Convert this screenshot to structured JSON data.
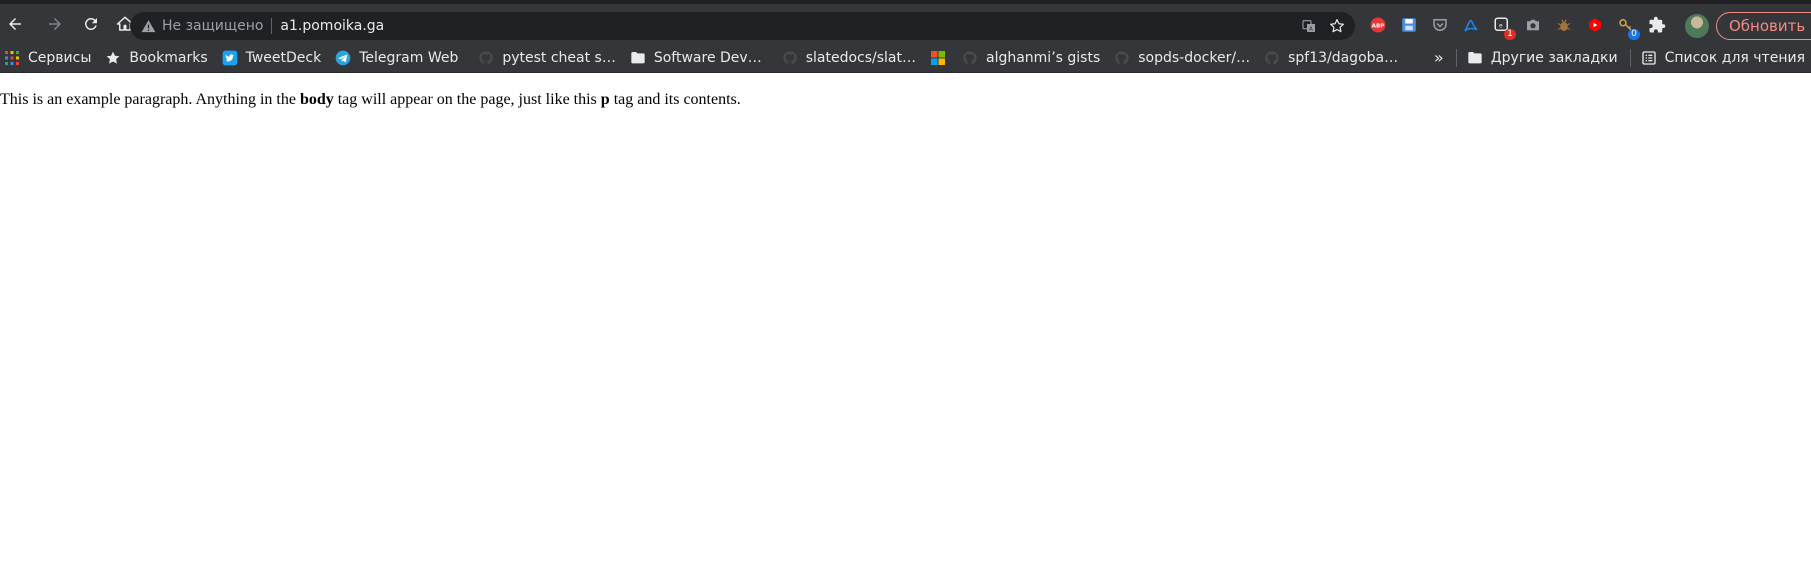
{
  "toolbar": {
    "security_label": "Не защищено",
    "url": "a1.pomoika.ga",
    "update_label": "Обновить",
    "extensions": [
      {
        "name": "adblock-plus-icon",
        "label": "ABP",
        "color": "#e53935"
      },
      {
        "name": "save-icon",
        "color": "#4a90e2"
      },
      {
        "name": "pocket-icon",
        "color": "#9aa0a6"
      },
      {
        "name": "acrobat-icon",
        "color": "#1e88e5"
      },
      {
        "name": "extension-badge-icon",
        "badge": "1",
        "badge_color": "#d93025"
      },
      {
        "name": "camera-icon",
        "color": "#9aa0a6"
      },
      {
        "name": "bug-icon",
        "color": "#a0743b"
      },
      {
        "name": "youtube-icon",
        "color": "#ff0000"
      },
      {
        "name": "key-icon",
        "badge": "0",
        "badge_color": "#1a73e8"
      },
      {
        "name": "puzzle-icon",
        "color": "#9aa0a6"
      }
    ]
  },
  "bookmarks": {
    "items": [
      {
        "name": "bookmark-apps",
        "icon": "apps-grid-icon",
        "label": "Сервисы"
      },
      {
        "name": "bookmark-bookmarks",
        "icon": "star-icon",
        "label": "Bookmarks"
      },
      {
        "name": "bookmark-tweetdeck",
        "icon": "twitter-icon",
        "label": "TweetDeck"
      },
      {
        "name": "bookmark-telegram",
        "icon": "telegram-icon",
        "label": "Telegram Web"
      },
      {
        "name": "bookmark-pytest",
        "icon": "github-icon",
        "label": "pytest cheat s…"
      },
      {
        "name": "bookmark-software-dev",
        "icon": "folder-icon",
        "label": "Software Dev…"
      },
      {
        "name": "bookmark-slatedocs",
        "icon": "github-icon",
        "label": "slatedocs/slat…"
      },
      {
        "name": "bookmark-microsoft",
        "icon": "microsoft-icon",
        "label": ""
      },
      {
        "name": "bookmark-alghanmi",
        "icon": "github-icon",
        "label": "alghanmi’s gists"
      },
      {
        "name": "bookmark-sopds",
        "icon": "github-icon",
        "label": "sopds-docker/…"
      },
      {
        "name": "bookmark-spf13",
        "icon": "github-icon",
        "label": "spf13/dagoba…"
      }
    ],
    "more": "»",
    "other_bookmarks": "Другие закладки",
    "reading_list": "Список для чтения"
  },
  "page": {
    "p_part1": "This is an example paragraph. Anything in the ",
    "p_bold1": "body",
    "p_part2": " tag will appear on the page, just like this ",
    "p_bold2": "p",
    "p_part3": " tag and its contents."
  }
}
